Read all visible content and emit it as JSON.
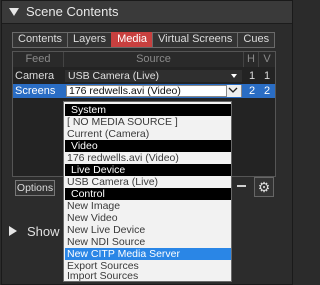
{
  "title": "Scene Contents",
  "tabs": [
    {
      "label": "Contents",
      "active": false
    },
    {
      "label": "Layers",
      "active": false
    },
    {
      "label": "Media",
      "active": true
    },
    {
      "label": "Virtual Screens",
      "active": false
    },
    {
      "label": "Cues",
      "active": false
    }
  ],
  "table": {
    "columns": [
      "Feed",
      "Source",
      "H",
      "V"
    ],
    "rows": [
      {
        "feed": "Camera",
        "source": "USB Camera (Live)",
        "h": "1",
        "v": "1"
      },
      {
        "feed": "Screens",
        "source": "176 redwells.avi (Video)",
        "h": "2",
        "v": "2"
      }
    ]
  },
  "dropdown": {
    "items": [
      {
        "label": "System",
        "type": "header"
      },
      {
        "label": "[ NO MEDIA SOURCE ]",
        "type": "item"
      },
      {
        "label": "Current (Camera)",
        "type": "item"
      },
      {
        "label": "Video",
        "type": "header"
      },
      {
        "label": "176 redwells.avi (Video)",
        "type": "item"
      },
      {
        "label": "Live Device",
        "type": "header"
      },
      {
        "label": "USB Camera (Live)",
        "type": "item"
      },
      {
        "label": "Control",
        "type": "header"
      },
      {
        "label": "New Image",
        "type": "item"
      },
      {
        "label": "New Video",
        "type": "item"
      },
      {
        "label": "New Live Device",
        "type": "item"
      },
      {
        "label": "New NDI Source",
        "type": "item"
      },
      {
        "label": "New CITP Media Server",
        "type": "highlighted"
      },
      {
        "label": "Export Sources",
        "type": "item"
      },
      {
        "label": "Import Sources",
        "type": "item"
      }
    ]
  },
  "buttons": {
    "options": "Options"
  },
  "icons": {
    "gear": "gear-icon",
    "minus": "minus-icon"
  },
  "show_section": {
    "label": "Show"
  },
  "colors": {
    "active_tab": "#c8403f",
    "selection": "#2a6dc4",
    "highlight": "#2a86e6"
  }
}
